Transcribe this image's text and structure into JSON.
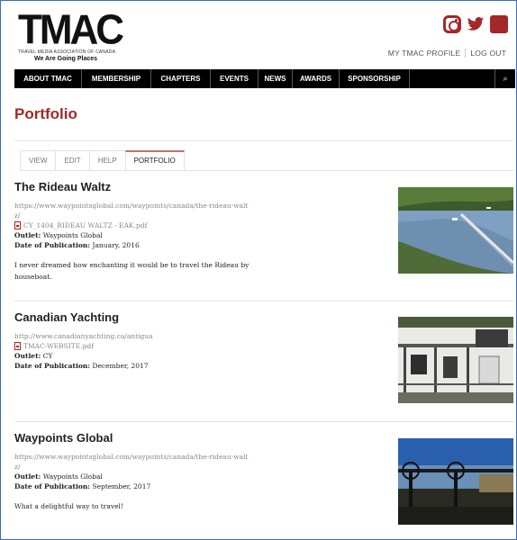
{
  "logo": {
    "word": "TMAC",
    "subtitle": "TRAVEL MEDIA ASSOCIATION OF CANADA",
    "tagline": "We Are Going Places"
  },
  "social": {
    "twitter": "🐦",
    "facebook": "f"
  },
  "user_links": {
    "profile": "MY TMAC PROFILE",
    "logout": "LOG OUT"
  },
  "nav": {
    "items": [
      "ABOUT TMAC",
      "MEMBERSHIP",
      "CHAPTERS",
      "EVENTS",
      "NEWS",
      "AWARDS",
      "SPONSORSHIP"
    ],
    "search_icon": "⌕"
  },
  "page_title": "Portfolio",
  "tabs": [
    "VIEW",
    "EDIT",
    "HELP",
    "PORTFOLIO"
  ],
  "labels": {
    "outlet": "Outlet:",
    "date": "Date of Publication:"
  },
  "entries": [
    {
      "title": "The Rideau Waltz",
      "url": "https://www.waypointsglobal.com/waypoints/canada/the-rideau-waltz/",
      "file": "CY_1404_RIDEAU WALTZ - EAK.pdf",
      "outlet": "Waypoints Global",
      "date": "January, 2016",
      "description": "I never dreamed how enchanting it would be to travel the Rideau by houseboat."
    },
    {
      "title": "Canadian Yachting",
      "url": "http://www.canadianyachting.ca/antigua",
      "file": "TMAC-WEBSITE.pdf",
      "outlet": "CY",
      "date": "December, 2017",
      "description": ""
    },
    {
      "title": "Waypoints Global",
      "url": "https://www.waypointsglobal.com/waypoints/canada/the-rideau-waltz/",
      "file": "",
      "outlet": "Waypoints Global",
      "date": "September, 2017",
      "description": "What a delightful way to travel!"
    }
  ],
  "colors": {
    "brand": "#a3282a",
    "nav_bg": "#000000"
  }
}
